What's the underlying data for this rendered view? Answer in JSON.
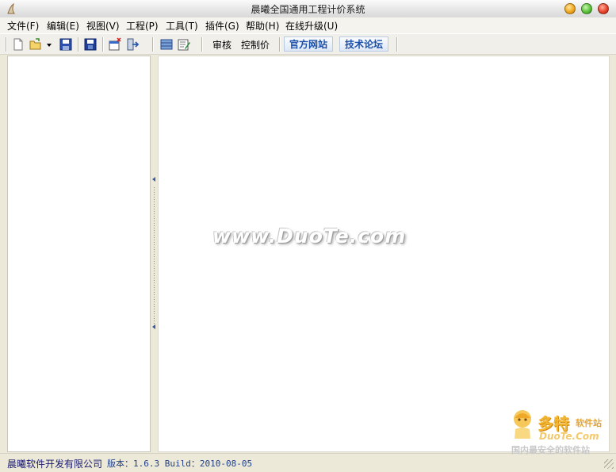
{
  "window": {
    "title": "晨曦全国通用工程计价系统"
  },
  "menu": {
    "items": [
      {
        "label": "文件(F)"
      },
      {
        "label": "编辑(E)"
      },
      {
        "label": "视图(V)"
      },
      {
        "label": "工程(P)"
      },
      {
        "label": "工具(T)"
      },
      {
        "label": "插件(G)"
      },
      {
        "label": "帮助(H)"
      },
      {
        "label": "在线升级(U)"
      }
    ]
  },
  "toolbar": {
    "icons": [
      "new-file-icon",
      "open-folder-icon",
      "dropdown-arrow-icon",
      "save-icon",
      "save-as-icon",
      "new-window-icon",
      "exit-icon",
      "database-icon",
      "edit-report-icon"
    ],
    "audit_label": "审核",
    "control_price_label": "控制价",
    "official_site_label": "官方网站",
    "tech_forum_label": "技术论坛"
  },
  "watermark": {
    "text": "www.DuoTe.com"
  },
  "status": {
    "company": "晨曦软件开发有限公司",
    "version": "版本：1.6.3 Build：2010-08-05"
  },
  "logo": {
    "name": "多特",
    "tag": "软件站",
    "domain": "DuoTe.Com",
    "slogan": "国内最安全的软件站"
  },
  "colors": {
    "link_text": "#1b4fa8",
    "status_text": "#1f3f88",
    "chrome": "#ece9d8"
  }
}
